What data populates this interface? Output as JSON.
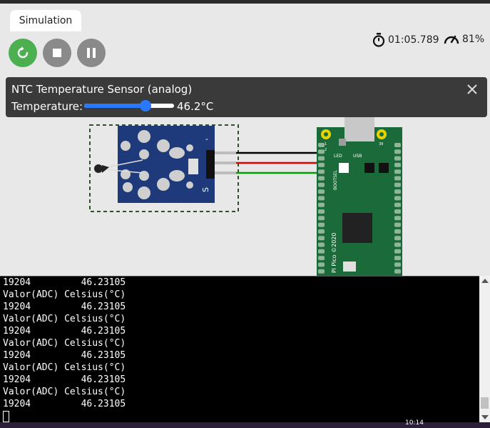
{
  "tabs": [
    {
      "label": "Simulation"
    }
  ],
  "controls": {
    "restart": {
      "icon": "restart-icon",
      "color": "#4caf50"
    },
    "stop": {
      "icon": "stop-icon"
    },
    "pause": {
      "icon": "pause-icon"
    }
  },
  "status": {
    "timer": "01:05.789",
    "timer_icon": "stopwatch-icon",
    "speed": "81%",
    "speed_icon": "speedometer-icon"
  },
  "sensor_panel": {
    "title": "NTC Temperature Sensor (analog)",
    "temp_label": "Temperature:",
    "temp_value": "46.2°C",
    "slider_fraction": 0.68,
    "accent": "#2979ff"
  },
  "board": {
    "chip_label": "Pi Pico ©2020",
    "led_label": "LED",
    "usb_label": "USB",
    "bootsel_label": "BOOTSEL",
    "pin1": "1",
    "pin2": "2",
    "pin39": "39",
    "pin40": "40"
  },
  "sensor_module": {
    "pin_label": "S",
    "minus_label": "-"
  },
  "wires": [
    {
      "color": "#000000"
    },
    {
      "color": "#e00000"
    },
    {
      "color": "#00a000"
    }
  ],
  "terminal": {
    "lines": [
      "19204         46.23105",
      "Valor(ADC) Celsius(°C)",
      "19204         46.23105",
      "Valor(ADC) Celsius(°C)",
      "19204         46.23105",
      "Valor(ADC) Celsius(°C)",
      "19204         46.23105",
      "Valor(ADC) Celsius(°C)",
      "19204         46.23105",
      "Valor(ADC) Celsius(°C)",
      "19204         46.23105"
    ]
  },
  "taskbar": {
    "clock": "10:14"
  }
}
